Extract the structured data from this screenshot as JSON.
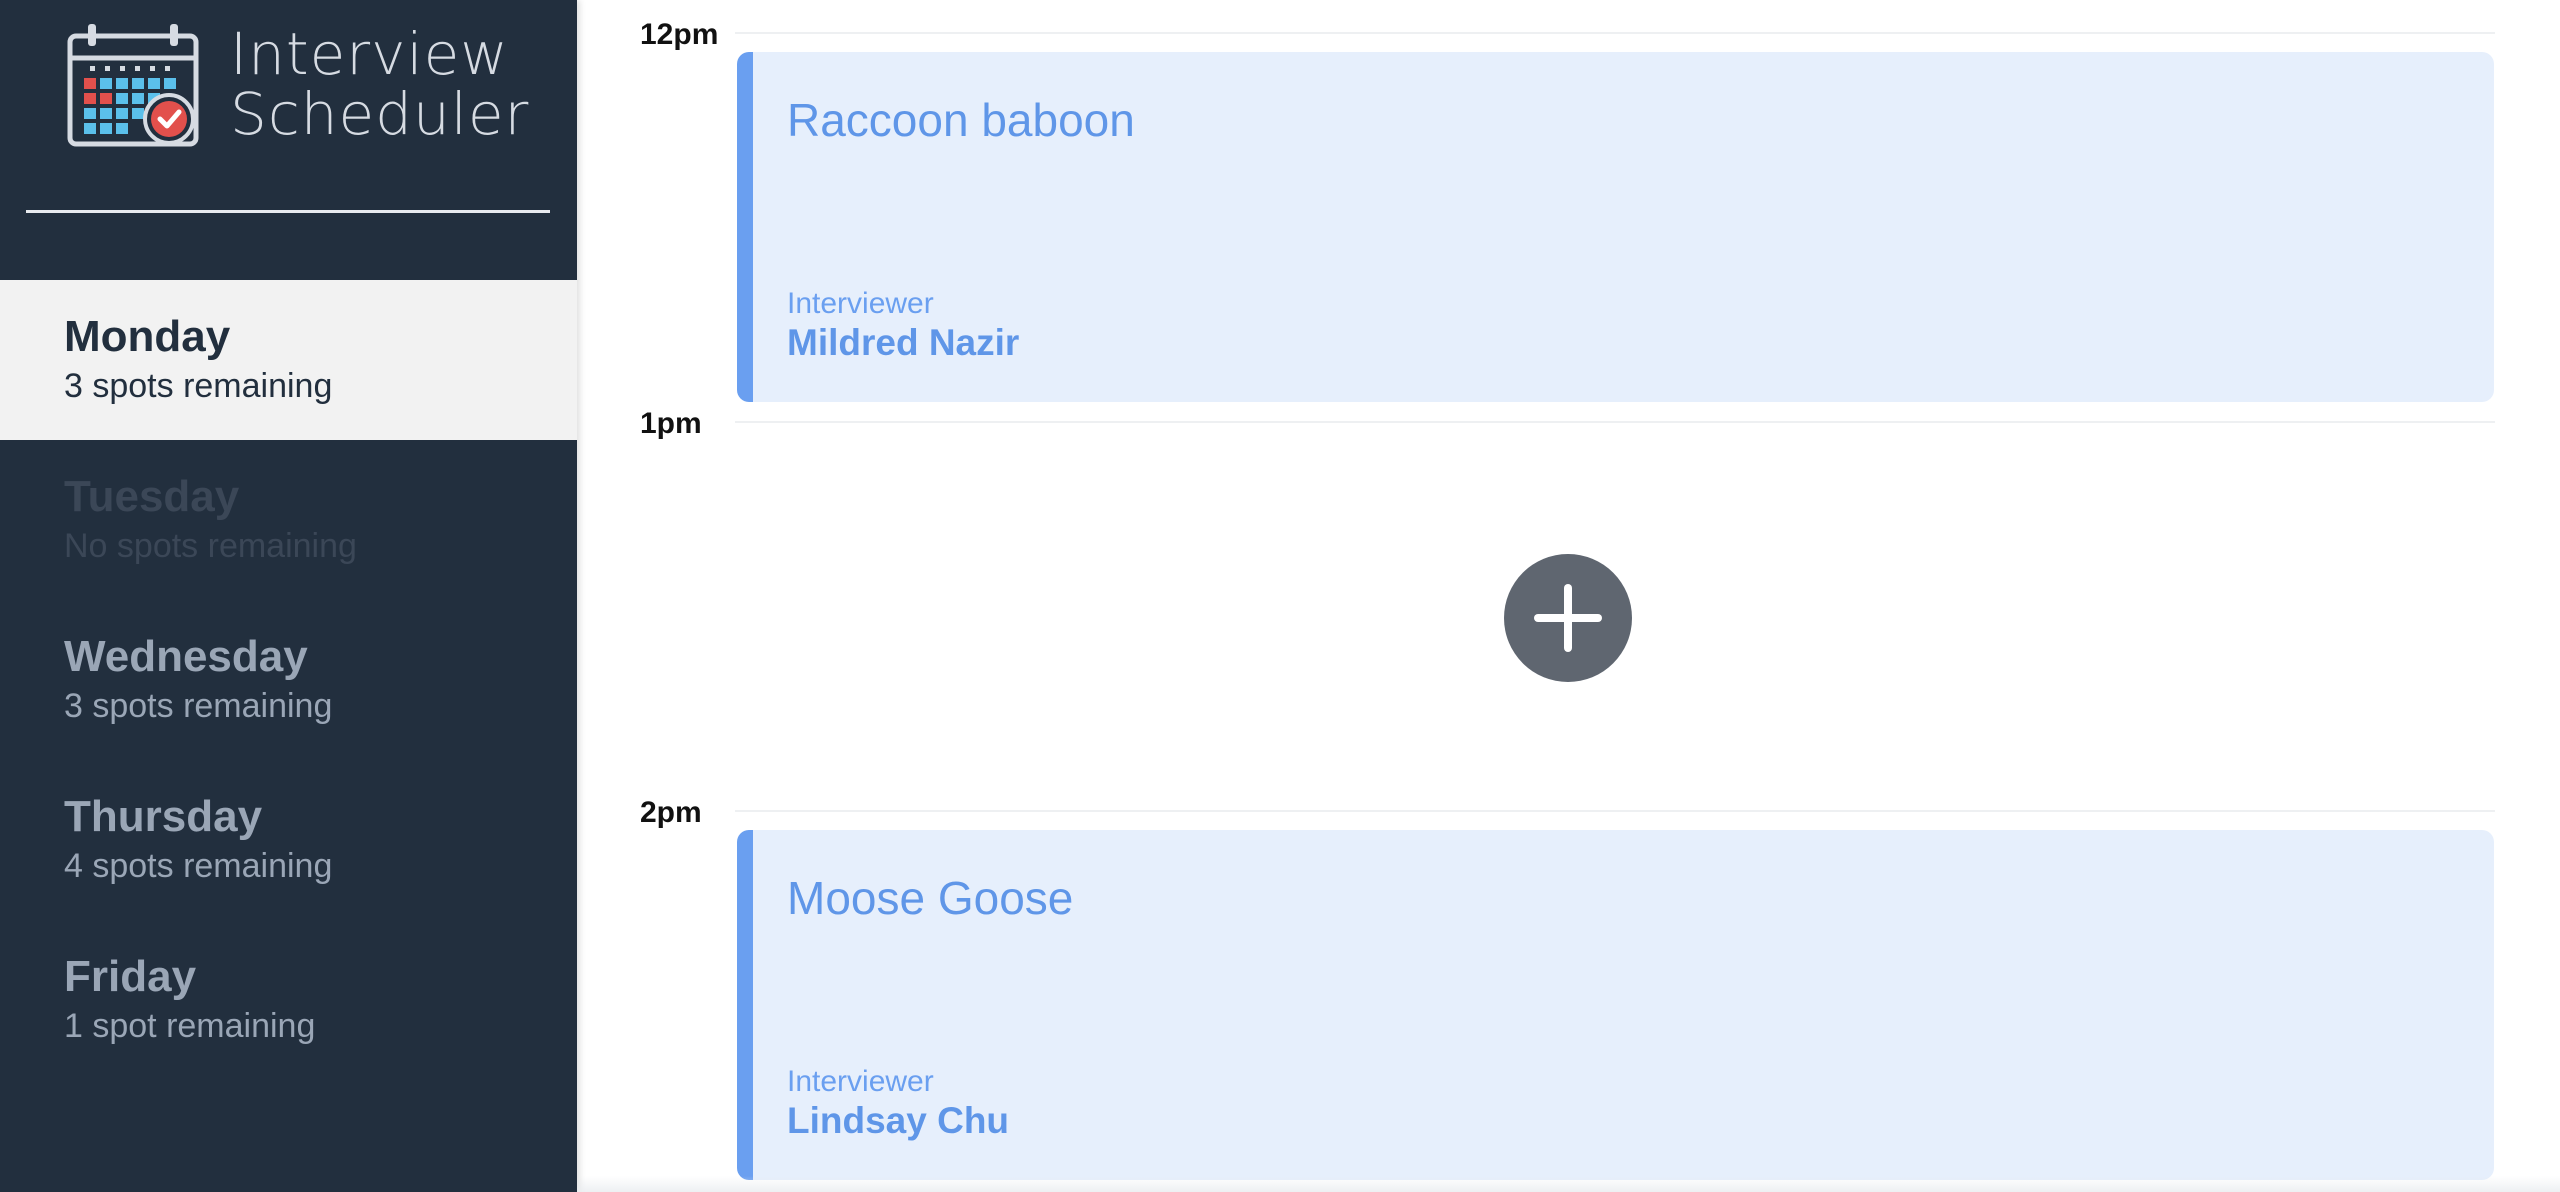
{
  "brand": {
    "line1": "Interview",
    "line2": "Scheduler",
    "logo_icon": "calendar-check-icon"
  },
  "days": [
    {
      "name": "Monday",
      "spots": "3 spots remaining",
      "state": "selected"
    },
    {
      "name": "Tuesday",
      "spots": "No spots remaining",
      "state": "full"
    },
    {
      "name": "Wednesday",
      "spots": "3 spots remaining",
      "state": "normal"
    },
    {
      "name": "Thursday",
      "spots": "4 spots remaining",
      "state": "normal"
    },
    {
      "name": "Friday",
      "spots": "1 spot remaining",
      "state": "normal"
    }
  ],
  "schedule": {
    "times": [
      "12pm",
      "1pm",
      "2pm"
    ],
    "appointments": [
      {
        "time": "12pm",
        "student": "Raccoon baboon",
        "interviewer_label": "Interviewer",
        "interviewer": "Mildred Nazir"
      },
      {
        "time": "1pm",
        "empty": true,
        "add_icon": "plus-icon"
      },
      {
        "time": "2pm",
        "student": "Moose Goose",
        "interviewer_label": "Interviewer",
        "interviewer": "Lindsay Chu"
      }
    ]
  },
  "colors": {
    "sidebar_bg": "#222f3e",
    "selected_bg": "#f2f2f2",
    "accent": "#6a9ff0",
    "card_bg": "#e6effc",
    "add_button": "#5f6670"
  }
}
